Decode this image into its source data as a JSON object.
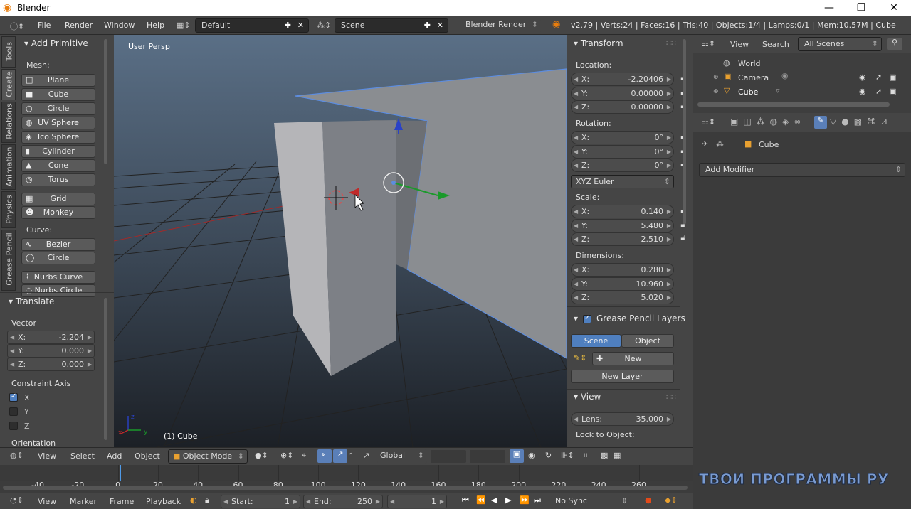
{
  "window": {
    "title": "Blender"
  },
  "topbar": {
    "menus": [
      "File",
      "Render",
      "Window",
      "Help"
    ],
    "layout": "Default",
    "scene": "Scene",
    "engine": "Blender Render",
    "stats": "v2.79 | Verts:24 | Faces:16 | Tris:40 | Objects:1/4 | Lamps:0/1 | Mem:10.57M | Cube"
  },
  "tool_tabs": [
    "Tools",
    "Create",
    "Relations",
    "Animation",
    "Physics",
    "Grease Pencil"
  ],
  "add_primitive": {
    "header": "Add Primitive",
    "mesh_label": "Mesh:",
    "mesh": [
      {
        "label": "Plane",
        "icon": "plane-icon"
      },
      {
        "label": "Cube",
        "icon": "cube-icon"
      },
      {
        "label": "Circle",
        "icon": "circle-icon"
      },
      {
        "label": "UV Sphere",
        "icon": "uv-sphere-icon"
      },
      {
        "label": "Ico Sphere",
        "icon": "ico-sphere-icon"
      },
      {
        "label": "Cylinder",
        "icon": "cylinder-icon"
      },
      {
        "label": "Cone",
        "icon": "cone-icon"
      },
      {
        "label": "Torus",
        "icon": "torus-icon"
      },
      {
        "label": "Grid",
        "icon": "grid-icon"
      },
      {
        "label": "Monkey",
        "icon": "monkey-icon"
      }
    ],
    "curve_label": "Curve:",
    "curve": [
      {
        "label": "Bezier",
        "icon": "bezier-icon"
      },
      {
        "label": "Circle",
        "icon": "curve-circle-icon"
      },
      {
        "label": "Nurbs Curve",
        "icon": "nurbs-curve-icon"
      },
      {
        "label": "Nurbs Circle",
        "icon": "nurbs-circle-icon"
      }
    ]
  },
  "translate": {
    "header": "Translate",
    "vector_label": "Vector",
    "x_label": "X:",
    "x": "-2.204",
    "y_label": "Y:",
    "y": "0.000",
    "z_label": "Z:",
    "z": "0.000",
    "constraint_label": "Constraint Axis",
    "axes": [
      {
        "label": "X",
        "checked": true
      },
      {
        "label": "Y",
        "checked": false
      },
      {
        "label": "Z",
        "checked": false
      }
    ],
    "orientation_label": "Orientation"
  },
  "viewport": {
    "label": "User Persp",
    "object_label": "(1) Cube"
  },
  "transform": {
    "header": "Transform",
    "location_label": "Location:",
    "location": {
      "x": "-2.20406",
      "y": "0.00000",
      "z": "0.00000"
    },
    "rotation_label": "Rotation:",
    "rotation": {
      "x": "0°",
      "y": "0°",
      "z": "0°"
    },
    "rotation_mode": "XYZ Euler",
    "scale_label": "Scale:",
    "scale": {
      "x": "0.140",
      "y": "5.480",
      "z": "2.510"
    },
    "dimensions_label": "Dimensions:",
    "dimensions": {
      "x": "0.280",
      "y": "10.960",
      "z": "5.020"
    },
    "xl": "X:",
    "yl": "Y:",
    "zl": "Z:"
  },
  "grease_pencil": {
    "header": "Grease Pencil Layers",
    "scene_tab": "Scene",
    "object_tab": "Object",
    "new_label": "New",
    "new_layer_label": "New Layer"
  },
  "view_panel": {
    "header": "View",
    "lens_label": "Lens:",
    "lens": "35.000",
    "lock_label": "Lock to Object:"
  },
  "outliner": {
    "view": "View",
    "search": "Search",
    "filter": "All Scenes",
    "items": [
      {
        "label": "World",
        "icon": "world-icon"
      },
      {
        "label": "Camera",
        "icon": "camera-icon"
      },
      {
        "label": "Cube",
        "icon": "mesh-icon"
      }
    ]
  },
  "properties": {
    "object_name": "Cube",
    "add_modifier": "Add Modifier"
  },
  "viewport_header": {
    "view": "View",
    "select": "Select",
    "add": "Add",
    "object": "Object",
    "mode": "Object Mode",
    "orientation": "Global"
  },
  "timeline": {
    "ticks": [
      "-40",
      "-20",
      "0",
      "20",
      "40",
      "60",
      "80",
      "100",
      "120",
      "140",
      "160",
      "180",
      "200",
      "220",
      "240",
      "260"
    ]
  },
  "timeline_footer": {
    "view": "View",
    "marker": "Marker",
    "frame": "Frame",
    "playback": "Playback",
    "start_label": "Start:",
    "start": "1",
    "end_label": "End:",
    "end": "250",
    "current": "1",
    "sync": "No Sync"
  },
  "watermark": "ТВОИ ПРОГРАММЫ РУ",
  "colors": {
    "accent": "#4f7fbf",
    "panel": "#454545",
    "background": "#393939"
  }
}
